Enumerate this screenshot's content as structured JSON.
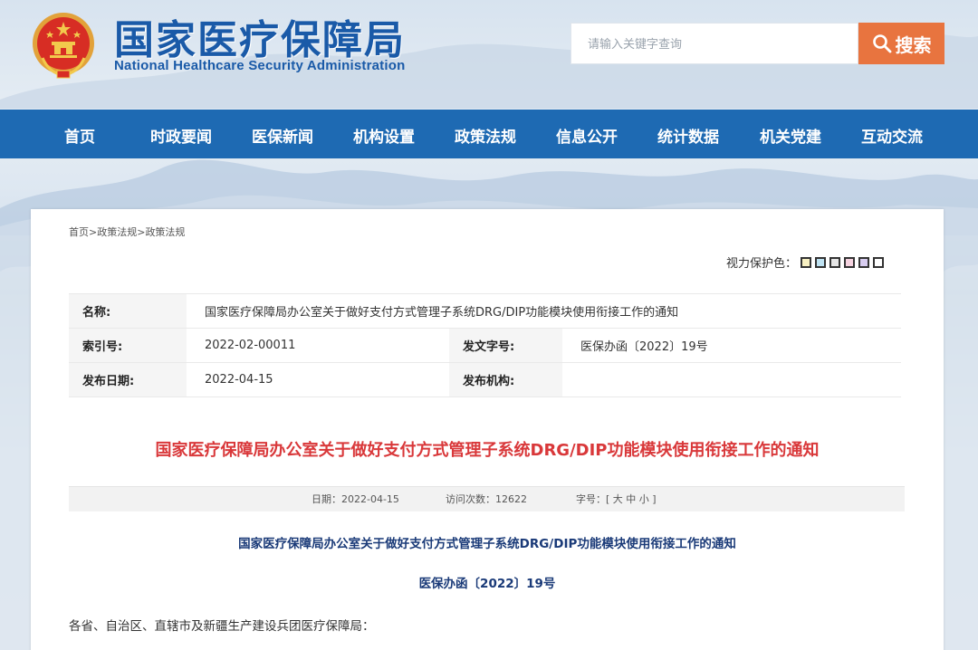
{
  "header": {
    "title": "国家医疗保障局",
    "subtitle": "National Healthcare Security Administration",
    "search_placeholder": "请输入关键字查询",
    "search_button": "搜索"
  },
  "nav": {
    "items": [
      "首页",
      "时政要闻",
      "医保新闻",
      "机构设置",
      "政策法规",
      "信息公开",
      "统计数据",
      "机关党建",
      "互动交流"
    ]
  },
  "breadcrumb": [
    "首页",
    "政策法规",
    "政策法规"
  ],
  "vision_protection": {
    "label": "视力保护色：",
    "colors": [
      "#f7f0c2",
      "#bfe3f3",
      "#e6e6e6",
      "#f6d3e0",
      "#d8cdf0",
      "#ffffff"
    ]
  },
  "meta": {
    "name_label": "名称:",
    "name_value": "国家医疗保障局办公室关于做好支付方式管理子系统DRG/DIP功能模块使用衔接工作的通知",
    "index_label": "索引号:",
    "index_value": "2022-02-00011",
    "docno_label": "发文字号:",
    "docno_value": "医保办函〔2022〕19号",
    "date_label": "发布日期:",
    "date_value": "2022-04-15",
    "org_label": "发布机构:",
    "org_value": ""
  },
  "article": {
    "title": "国家医疗保障局办公室关于做好支付方式管理子系统DRG/DIP功能模块使用衔接工作的通知",
    "date_label": "日期：",
    "date": "2022-04-15",
    "visits_label": "访问次数：",
    "visits": "12622",
    "fontsize_label": "字号：[",
    "fontsize_large": "大",
    "fontsize_medium": "中",
    "fontsize_small": "小",
    "fontsize_end": "]",
    "heading": "国家医疗保障局办公室关于做好支付方式管理子系统DRG/DIP功能模块使用衔接工作的通知",
    "doc_number": "医保办函〔2022〕19号",
    "salutation": "各省、自治区、直辖市及新疆生产建设兵团医疗保障局："
  },
  "colors": {
    "nav_bg": "#1e6ab3",
    "brand_blue": "#1a5aa8",
    "search_button": "#e8743f",
    "title_red": "#d9383a",
    "heading_navy": "#1a3a78"
  }
}
